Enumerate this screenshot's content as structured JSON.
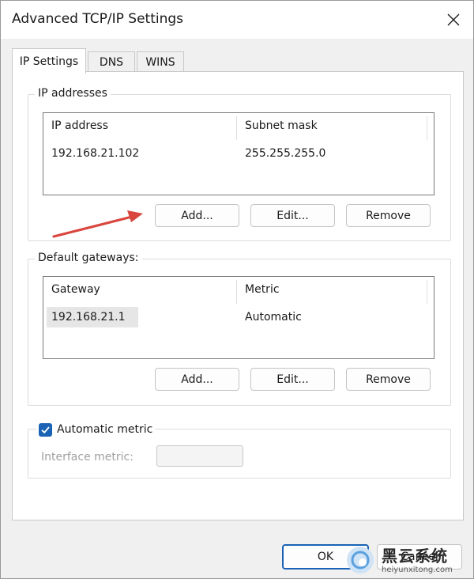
{
  "window": {
    "title": "Advanced TCP/IP Settings"
  },
  "tabs": [
    {
      "label": "IP Settings",
      "active": true
    },
    {
      "label": "DNS",
      "active": false
    },
    {
      "label": "WINS",
      "active": false
    }
  ],
  "ip_addresses": {
    "group_label": "IP addresses",
    "columns": [
      "IP address",
      "Subnet mask"
    ],
    "rows": [
      {
        "ip": "192.168.21.102",
        "mask": "255.255.255.0"
      }
    ],
    "buttons": {
      "add": "Add...",
      "edit": "Edit...",
      "remove": "Remove"
    }
  },
  "gateways": {
    "group_label": "Default gateways:",
    "columns": [
      "Gateway",
      "Metric"
    ],
    "rows": [
      {
        "gateway": "192.168.21.1",
        "metric": "Automatic"
      }
    ],
    "buttons": {
      "add": "Add...",
      "edit": "Edit...",
      "remove": "Remove"
    }
  },
  "automatic_metric": {
    "label": "Automatic metric",
    "checked": true,
    "interface_metric_label": "Interface metric:",
    "interface_metric_value": ""
  },
  "footer": {
    "ok": "OK",
    "cancel": "Cancel"
  },
  "watermark": {
    "brand": "黑云系统",
    "site": "heiyunxitong.com"
  },
  "colors": {
    "accent": "#1a62b5",
    "arrow": "#d9463d"
  },
  "icons": {
    "close": "close-icon",
    "check": "check-icon",
    "annotation": "red-arrow-icon",
    "watermark_logo": "cloud-logo-icon"
  }
}
